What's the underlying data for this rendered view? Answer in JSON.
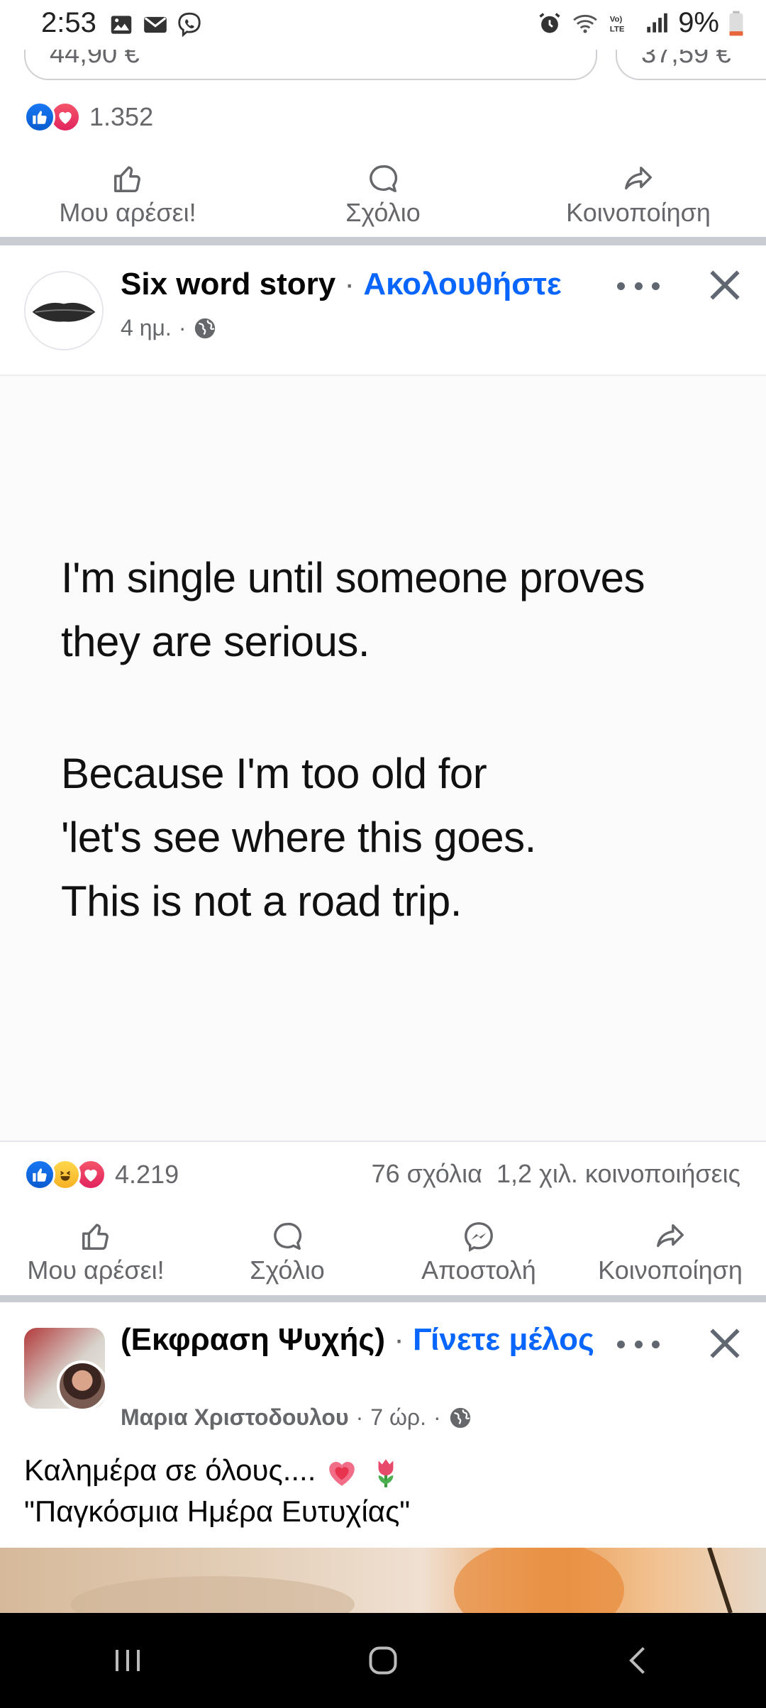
{
  "status_bar": {
    "time": "2:53",
    "battery": "9%",
    "left_icons": [
      "gallery-icon",
      "mail-icon",
      "viber-icon"
    ],
    "right_icons": [
      "alarm-icon",
      "wifi-icon",
      "volte-icon",
      "signal-icon",
      "battery-icon"
    ]
  },
  "previous_post": {
    "price_left": "44,90 €",
    "price_right": "37,59 €",
    "reaction_count": "1.352",
    "actions": {
      "like": "Μου αρέσει!",
      "comment": "Σχόλιο",
      "share": "Κοινοποίηση"
    }
  },
  "post1": {
    "author": "Six word story",
    "separator": "·",
    "follow_label": "Ακολουθήστε",
    "time": "4 ημ.",
    "meta_separator": "·",
    "image_text": [
      "I'm single until someone proves",
      "they are serious.",
      "Because I'm too old for",
      "'let's see where this goes.",
      "This is not a road trip."
    ],
    "reaction_count": "4.219",
    "comments": "76 σχόλια",
    "shares": "1,2 χιλ. κοινοποιήσεις",
    "actions": {
      "like": "Μου αρέσει!",
      "comment": "Σχόλιο",
      "send": "Αποστολή",
      "share": "Κοινοποίηση"
    }
  },
  "post2": {
    "group_name": "(Εκφραση Ψυχής)",
    "separator": "·",
    "join_label": "Γίνετε μέλος",
    "poster": "Μαρια Χριστοδουλου",
    "time": "7 ώρ.",
    "meta_separator": "·",
    "text_line1": "Καλημέρα σε όλους....",
    "text_line2": "\"Παγκόσμια Ημέρα Ευτυχίας\""
  }
}
